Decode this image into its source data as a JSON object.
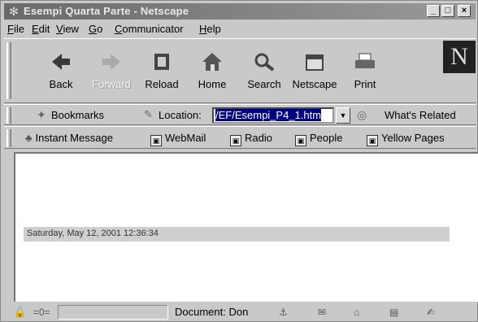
{
  "window": {
    "title": "Esempi Quarta Parte - Netscape",
    "controls": {
      "minimize": "_",
      "maximize": "□",
      "close": "×"
    }
  },
  "menu": [
    "File",
    "Edit",
    "View",
    "Go",
    "Communicator",
    "Help"
  ],
  "toolbar": {
    "buttons": [
      {
        "label": "Back",
        "icon": "back-arrow-icon",
        "enabled": true
      },
      {
        "label": "Forward",
        "icon": "forward-arrow-icon",
        "enabled": false
      },
      {
        "label": "Reload",
        "icon": "reload-icon",
        "enabled": true
      },
      {
        "label": "Home",
        "icon": "home-icon",
        "enabled": true
      },
      {
        "label": "Search",
        "icon": "search-icon",
        "enabled": true
      },
      {
        "label": "Netscape",
        "icon": "netscape-icon",
        "enabled": true
      },
      {
        "label": "Print",
        "icon": "print-icon",
        "enabled": true
      }
    ],
    "logo": "N"
  },
  "location": {
    "bookmarks_label": "Bookmarks",
    "location_label": "Location:",
    "url": "/EF/Esempi_P4_1.htm",
    "related_label": "What's Related"
  },
  "links": [
    "Instant Message",
    "WebMail",
    "Radio",
    "People",
    "Yellow Pages"
  ],
  "content": {
    "date_text": "Saturday, May 12, 2001 12:36:34"
  },
  "status": {
    "text": "Document: Don"
  }
}
